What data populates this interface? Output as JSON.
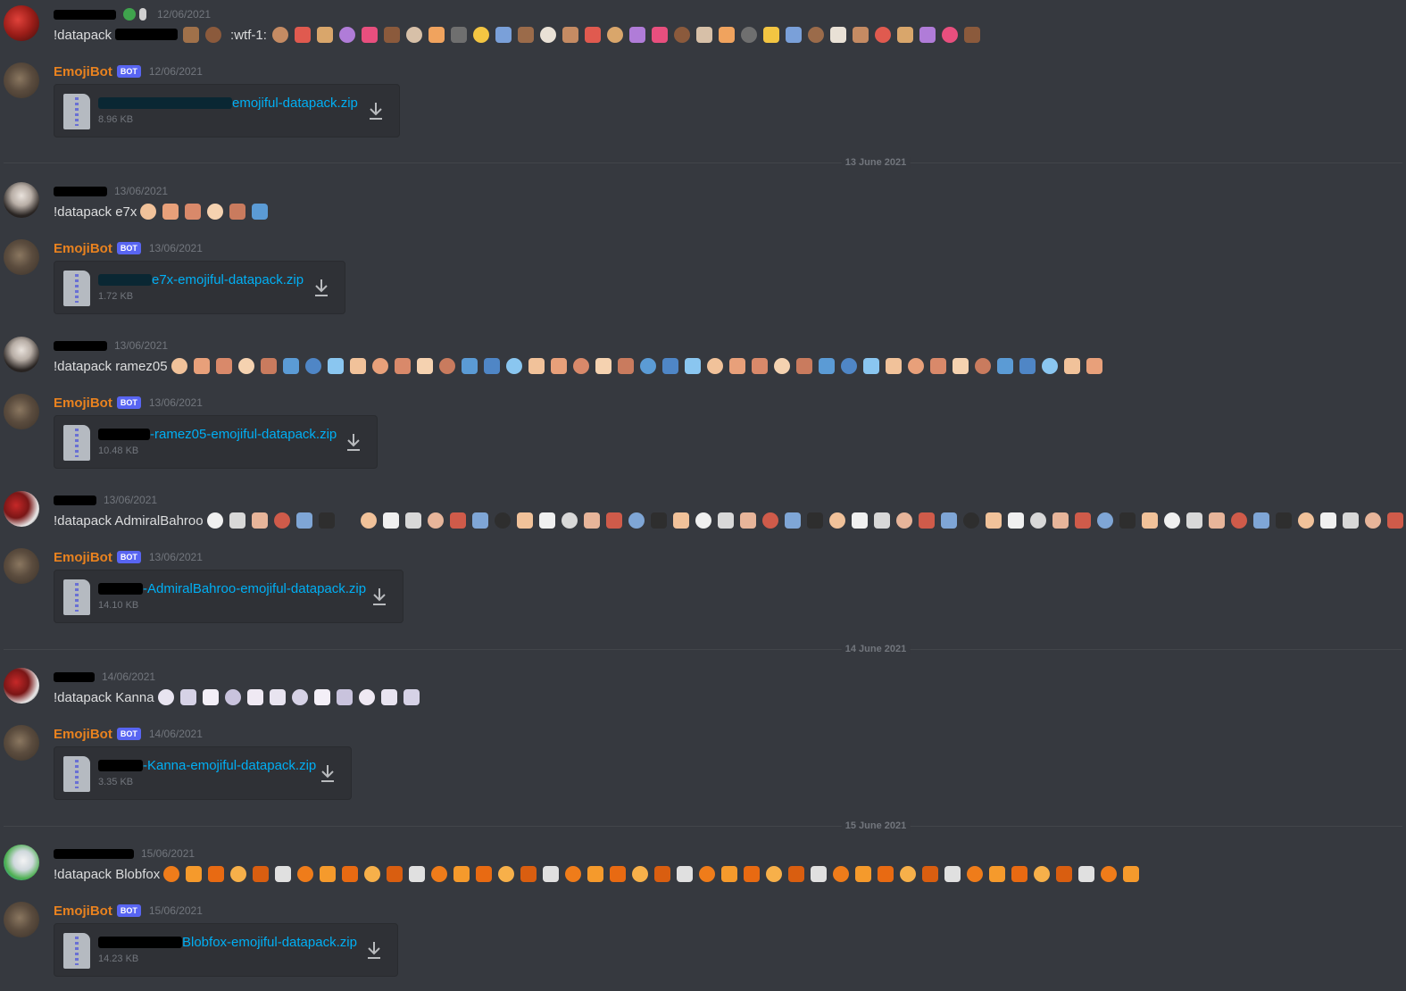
{
  "colors": {
    "background": "#36393f",
    "bot_name": "#e9821f",
    "bot_tag": "#5865f2",
    "link": "#00aff4",
    "timestamp": "#72767d"
  },
  "dividers": [
    "13 June 2021",
    "14 June 2021",
    "15 June 2021"
  ],
  "messages": [
    {
      "author_redacted": true,
      "timestamp": "12/06/2021",
      "command": "!datapack",
      "extra_text": ":wtf-1:"
    },
    {
      "author": "EmojiBot",
      "tag": "BOT",
      "timestamp": "12/06/2021",
      "file_name": "emojiful-datapack.zip",
      "file_size": "8.96 KB"
    },
    {
      "author_redacted": true,
      "timestamp": "13/06/2021",
      "command": "!datapack e7x"
    },
    {
      "author": "EmojiBot",
      "tag": "BOT",
      "timestamp": "13/06/2021",
      "file_name": "e7x-emojiful-datapack.zip",
      "file_size": "1.72 KB"
    },
    {
      "author_redacted": true,
      "timestamp": "13/06/2021",
      "command": "!datapack ramez05"
    },
    {
      "author": "EmojiBot",
      "tag": "BOT",
      "timestamp": "13/06/2021",
      "file_name": "-ramez05-emojiful-datapack.zip",
      "file_size": "10.48 KB"
    },
    {
      "author_redacted": true,
      "timestamp": "13/06/2021",
      "command": "!datapack AdmiralBahroo"
    },
    {
      "author": "EmojiBot",
      "tag": "BOT",
      "timestamp": "13/06/2021",
      "file_name": "-AdmiralBahroo-emojiful-datapack.zip",
      "file_size": "14.10 KB"
    },
    {
      "author_redacted": true,
      "timestamp": "14/06/2021",
      "command": "!datapack Kanna"
    },
    {
      "author": "EmojiBot",
      "tag": "BOT",
      "timestamp": "14/06/2021",
      "file_name": "-Kanna-emojiful-datapack.zip",
      "file_size": "3.35 KB"
    },
    {
      "author_redacted": true,
      "timestamp": "15/06/2021",
      "command": "!datapack Blobfox"
    },
    {
      "author": "EmojiBot",
      "tag": "BOT",
      "timestamp": "15/06/2021",
      "file_name": "Blobfox-emojiful-datapack.zip",
      "file_size": "14.23 KB"
    }
  ],
  "icons": {
    "download": "download-icon",
    "file": "zip-file-icon"
  }
}
